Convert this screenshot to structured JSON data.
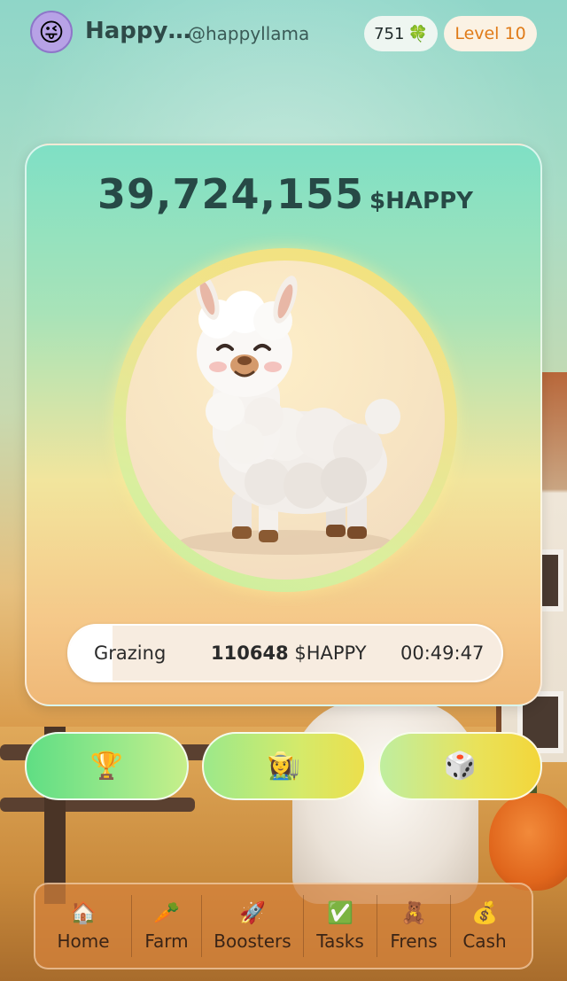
{
  "header": {
    "avatar_emoji": "😜",
    "username": "Happy…",
    "handle": "@happyllama",
    "coins": "751",
    "coins_icon": "🍀",
    "level": "Level 10"
  },
  "card": {
    "balance_amount": "39,724,155",
    "balance_unit": "$HAPPY",
    "mascot": "llama-mascot",
    "status": {
      "label": "Grazing",
      "reward_amount": "110648",
      "reward_unit": "$HAPPY",
      "timer": "00:49:47",
      "progress_fraction": 0.1
    }
  },
  "actions": [
    {
      "icon": "🏆",
      "name": "trophy-icon"
    },
    {
      "icon": "👩‍🌾",
      "name": "farmer-icon"
    },
    {
      "icon": "🎲",
      "name": "dice-icon"
    }
  ],
  "nav": [
    {
      "icon": "🏠",
      "label": "Home"
    },
    {
      "icon": "🥕",
      "label": "Farm"
    },
    {
      "icon": "🚀",
      "label": "Boosters"
    },
    {
      "icon": "✅",
      "label": "Tasks"
    },
    {
      "icon": "🧸",
      "label": "Frens"
    },
    {
      "icon": "💰",
      "label": "Cash"
    }
  ],
  "colors": {
    "level_text": "#e07b18",
    "balance_text": "#274946",
    "nav_bg": "#d6823c"
  }
}
